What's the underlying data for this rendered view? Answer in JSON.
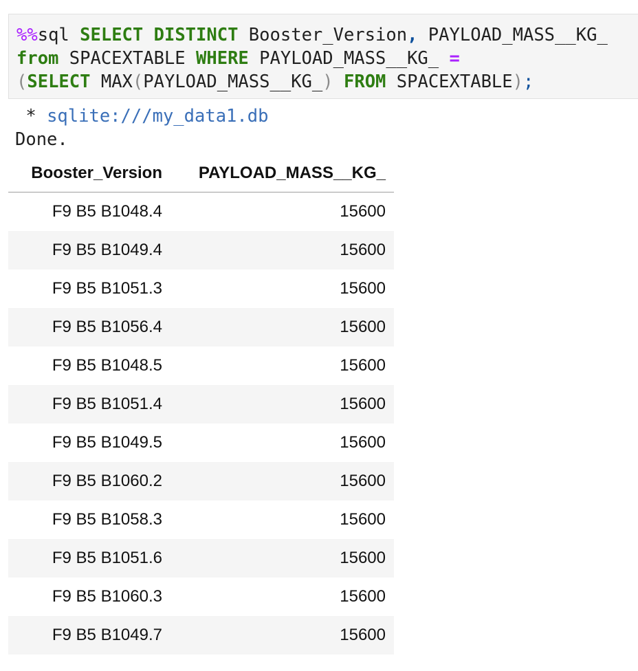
{
  "input_cell": {
    "line1": {
      "magic": "%%",
      "cmd": "sql ",
      "kw_select": "SELECT",
      "sp1": " ",
      "kw_distinct": "DISTINCT",
      "col1": " Booster_Version",
      "comma": ",",
      "col2": " PAYLOAD_MASS__KG_"
    },
    "line2": {
      "kw_from": "from",
      "table": " SPACEXTABLE ",
      "kw_where": "WHERE",
      "col": " PAYLOAD_MASS__KG_ ",
      "op_eq": "="
    },
    "line3": {
      "open_paren": "(",
      "kw_select": "SELECT",
      "fn_max": " MAX",
      "fn_open": "(",
      "col": "PAYLOAD_MASS__KG_",
      "fn_close": ")",
      "sp1": " ",
      "kw_from": "FROM",
      "table": " SPACEXTABLE",
      "close_paren": ")",
      "semicolon": ";"
    }
  },
  "output": {
    "connection_prefix": " * ",
    "connection": "sqlite:///my_data1.db",
    "status": "Done."
  },
  "table": {
    "columns": [
      "Booster_Version",
      "PAYLOAD_MASS__KG_"
    ],
    "rows": [
      [
        "F9 B5 B1048.4",
        "15600"
      ],
      [
        "F9 B5 B1049.4",
        "15600"
      ],
      [
        "F9 B5 B1051.3",
        "15600"
      ],
      [
        "F9 B5 B1056.4",
        "15600"
      ],
      [
        "F9 B5 B1048.5",
        "15600"
      ],
      [
        "F9 B5 B1051.4",
        "15600"
      ],
      [
        "F9 B5 B1049.5",
        "15600"
      ],
      [
        "F9 B5 B1060.2",
        "15600"
      ],
      [
        "F9 B5 B1058.3",
        "15600"
      ],
      [
        "F9 B5 B1051.6",
        "15600"
      ],
      [
        "F9 B5 B1060.3",
        "15600"
      ],
      [
        "F9 B5 B1049.7",
        "15600"
      ]
    ]
  }
}
